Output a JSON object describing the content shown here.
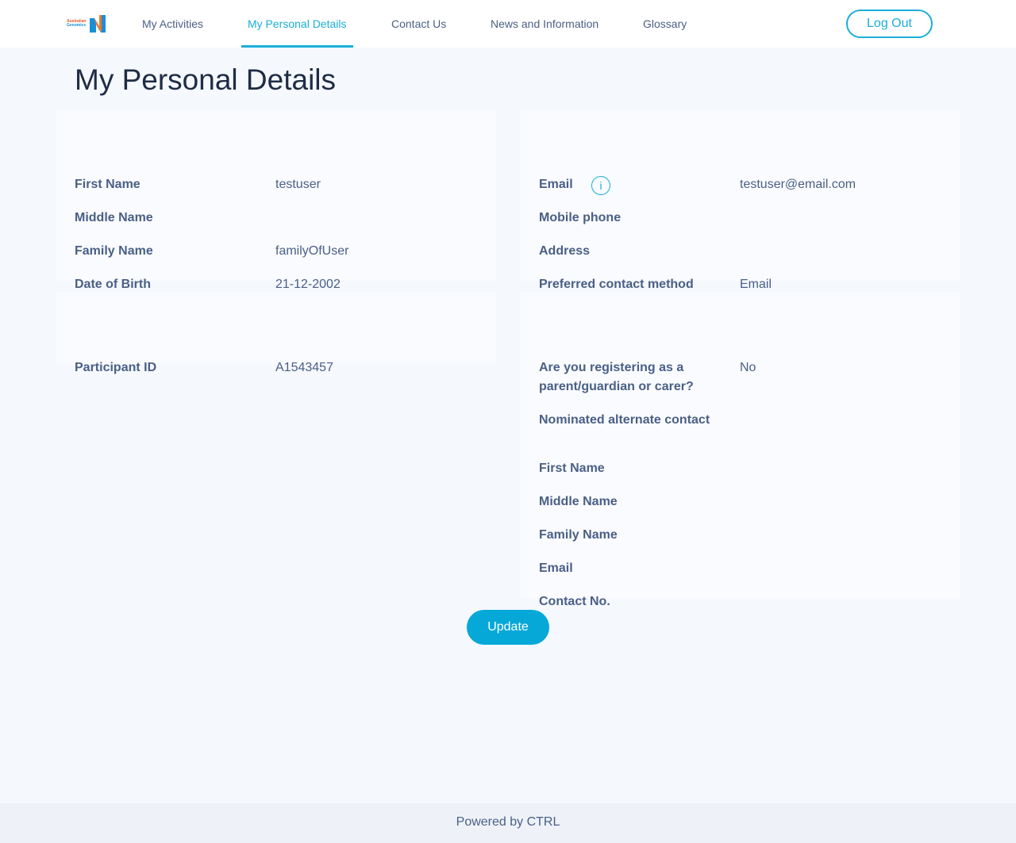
{
  "logo": {
    "line1": "Australian",
    "line2": "Genomics"
  },
  "nav": {
    "items": [
      "My Activities",
      "My Personal Details",
      "Contact Us",
      "News and Information",
      "Glossary"
    ],
    "logout": "Log Out"
  },
  "title": "My Personal Details",
  "personal": [
    {
      "label": "First Name",
      "value": "testuser"
    },
    {
      "label": "Middle Name",
      "value": ""
    },
    {
      "label": "Family Name",
      "value": "familyOfUser"
    },
    {
      "label": "Date of Birth",
      "value": "21-12-2002"
    }
  ],
  "contact": [
    {
      "label": "Email",
      "value": "testuser@email.com"
    },
    {
      "label": "Mobile phone",
      "value": ""
    },
    {
      "label": "Address",
      "value": ""
    },
    {
      "label": "Preferred contact method",
      "value": "Email"
    }
  ],
  "info_icon": "i",
  "participant": {
    "label": "Participant ID",
    "value": "A1543457"
  },
  "guardian": {
    "q1": "Are you registering as a",
    "q2": "parent/guardian or carer?",
    "value": "No",
    "alt": "Nominated alternate contact",
    "fields": [
      "First Name",
      "Middle Name",
      "Family Name",
      "Email",
      "Contact No."
    ]
  },
  "update": "Update",
  "footer": "Powered by CTRL"
}
